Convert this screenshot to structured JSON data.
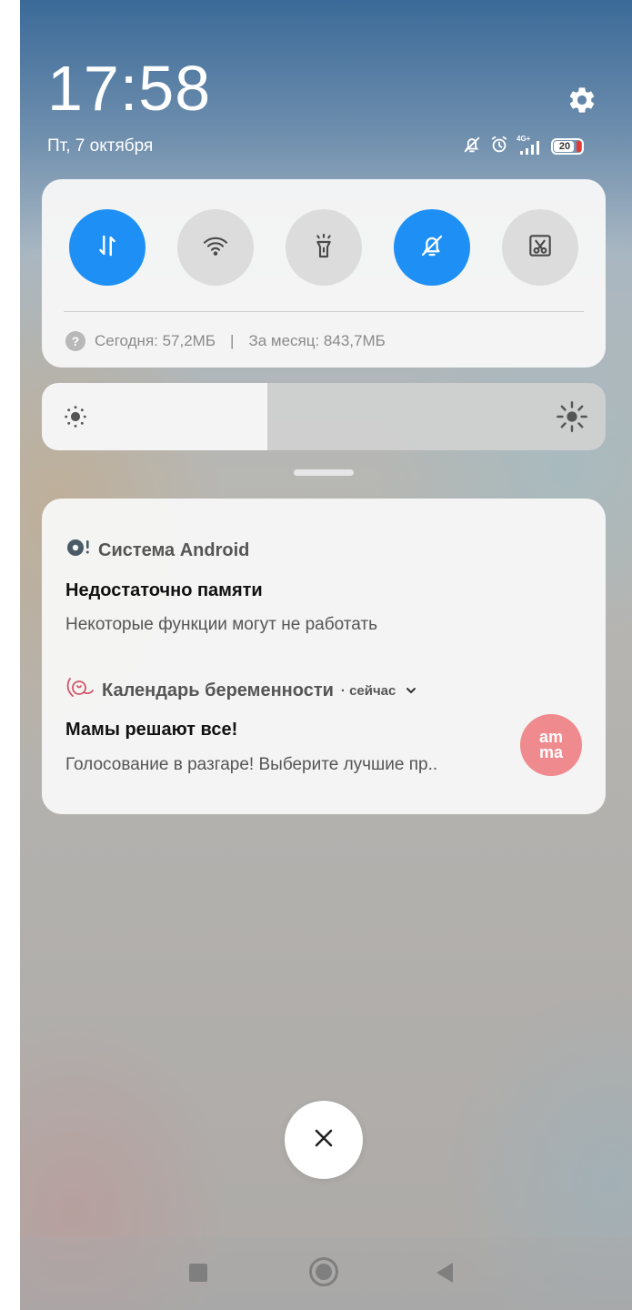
{
  "status": {
    "time": "17:58",
    "date": "Пт, 7 октября",
    "network": "4G+",
    "battery": "20",
    "icons": [
      "mute-icon",
      "alarm-icon",
      "signal-icon",
      "battery-icon"
    ]
  },
  "settings_icon": "gear-icon",
  "quick_settings": {
    "toggles": [
      {
        "name": "mobile-data",
        "icon": "data-transfer-icon",
        "active": true
      },
      {
        "name": "wifi",
        "icon": "wifi-icon",
        "active": false
      },
      {
        "name": "flashlight",
        "icon": "flashlight-icon",
        "active": false
      },
      {
        "name": "silent",
        "icon": "bell-off-icon",
        "active": true
      },
      {
        "name": "screenshot",
        "icon": "screenshot-icon",
        "active": false
      }
    ],
    "data_usage": {
      "today": "Сегодня: 57,2МБ",
      "separator": "|",
      "month": "За месяц: 843,7МБ"
    }
  },
  "brightness": {
    "level": 0.4
  },
  "notifications": [
    {
      "app": "Система Android",
      "title": "Недостаточно памяти",
      "text": "Некоторые функции могут не работать"
    },
    {
      "app": "Календарь беременности",
      "time": "· сейчас",
      "title": "Мамы решают все!",
      "text": "Голосование в разгаре! Выберите лучшие пр..",
      "avatar_line1": "am",
      "avatar_line2": "ma"
    }
  ],
  "colors": {
    "accent": "#1e90f5",
    "toggle_off": "#dcdcdc",
    "amma_avatar": "#ef8a8e"
  }
}
